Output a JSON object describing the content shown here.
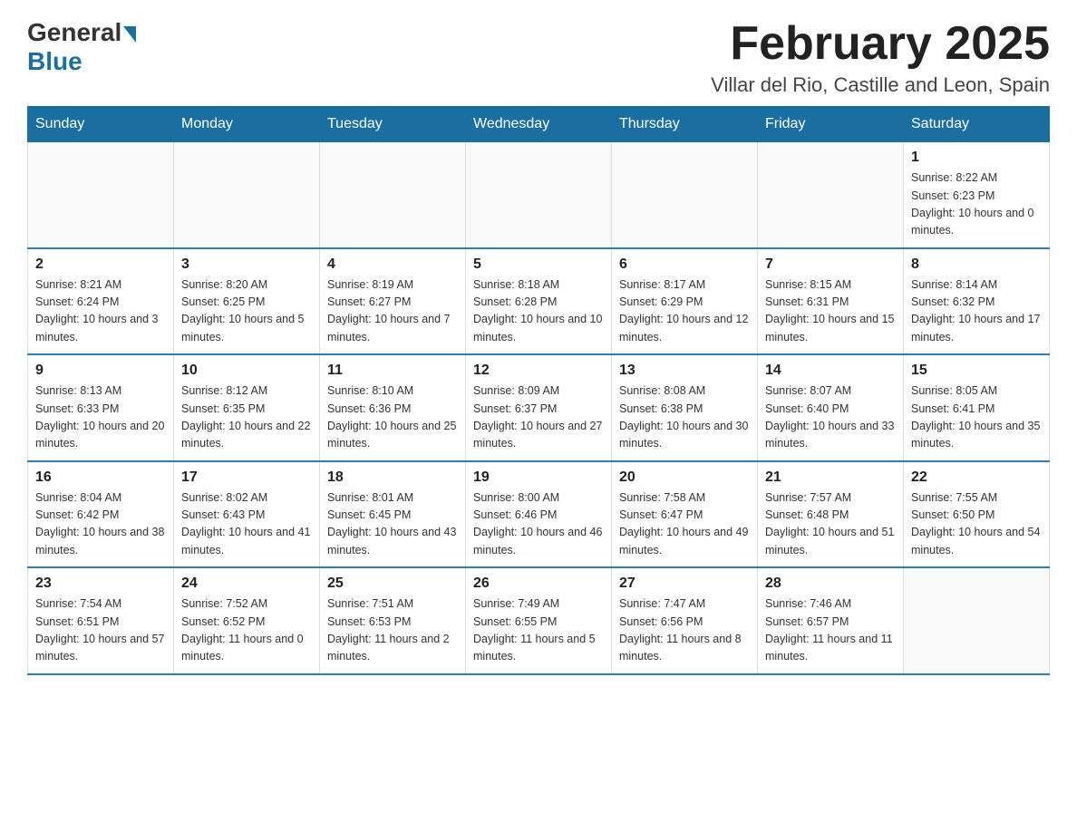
{
  "header": {
    "logo_general": "General",
    "logo_blue": "Blue",
    "month_title": "February 2025",
    "location": "Villar del Rio, Castille and Leon, Spain"
  },
  "weekdays": [
    "Sunday",
    "Monday",
    "Tuesday",
    "Wednesday",
    "Thursday",
    "Friday",
    "Saturday"
  ],
  "weeks": [
    [
      {
        "day": "",
        "info": ""
      },
      {
        "day": "",
        "info": ""
      },
      {
        "day": "",
        "info": ""
      },
      {
        "day": "",
        "info": ""
      },
      {
        "day": "",
        "info": ""
      },
      {
        "day": "",
        "info": ""
      },
      {
        "day": "1",
        "info": "Sunrise: 8:22 AM\nSunset: 6:23 PM\nDaylight: 10 hours and 0 minutes."
      }
    ],
    [
      {
        "day": "2",
        "info": "Sunrise: 8:21 AM\nSunset: 6:24 PM\nDaylight: 10 hours and 3 minutes."
      },
      {
        "day": "3",
        "info": "Sunrise: 8:20 AM\nSunset: 6:25 PM\nDaylight: 10 hours and 5 minutes."
      },
      {
        "day": "4",
        "info": "Sunrise: 8:19 AM\nSunset: 6:27 PM\nDaylight: 10 hours and 7 minutes."
      },
      {
        "day": "5",
        "info": "Sunrise: 8:18 AM\nSunset: 6:28 PM\nDaylight: 10 hours and 10 minutes."
      },
      {
        "day": "6",
        "info": "Sunrise: 8:17 AM\nSunset: 6:29 PM\nDaylight: 10 hours and 12 minutes."
      },
      {
        "day": "7",
        "info": "Sunrise: 8:15 AM\nSunset: 6:31 PM\nDaylight: 10 hours and 15 minutes."
      },
      {
        "day": "8",
        "info": "Sunrise: 8:14 AM\nSunset: 6:32 PM\nDaylight: 10 hours and 17 minutes."
      }
    ],
    [
      {
        "day": "9",
        "info": "Sunrise: 8:13 AM\nSunset: 6:33 PM\nDaylight: 10 hours and 20 minutes."
      },
      {
        "day": "10",
        "info": "Sunrise: 8:12 AM\nSunset: 6:35 PM\nDaylight: 10 hours and 22 minutes."
      },
      {
        "day": "11",
        "info": "Sunrise: 8:10 AM\nSunset: 6:36 PM\nDaylight: 10 hours and 25 minutes."
      },
      {
        "day": "12",
        "info": "Sunrise: 8:09 AM\nSunset: 6:37 PM\nDaylight: 10 hours and 27 minutes."
      },
      {
        "day": "13",
        "info": "Sunrise: 8:08 AM\nSunset: 6:38 PM\nDaylight: 10 hours and 30 minutes."
      },
      {
        "day": "14",
        "info": "Sunrise: 8:07 AM\nSunset: 6:40 PM\nDaylight: 10 hours and 33 minutes."
      },
      {
        "day": "15",
        "info": "Sunrise: 8:05 AM\nSunset: 6:41 PM\nDaylight: 10 hours and 35 minutes."
      }
    ],
    [
      {
        "day": "16",
        "info": "Sunrise: 8:04 AM\nSunset: 6:42 PM\nDaylight: 10 hours and 38 minutes."
      },
      {
        "day": "17",
        "info": "Sunrise: 8:02 AM\nSunset: 6:43 PM\nDaylight: 10 hours and 41 minutes."
      },
      {
        "day": "18",
        "info": "Sunrise: 8:01 AM\nSunset: 6:45 PM\nDaylight: 10 hours and 43 minutes."
      },
      {
        "day": "19",
        "info": "Sunrise: 8:00 AM\nSunset: 6:46 PM\nDaylight: 10 hours and 46 minutes."
      },
      {
        "day": "20",
        "info": "Sunrise: 7:58 AM\nSunset: 6:47 PM\nDaylight: 10 hours and 49 minutes."
      },
      {
        "day": "21",
        "info": "Sunrise: 7:57 AM\nSunset: 6:48 PM\nDaylight: 10 hours and 51 minutes."
      },
      {
        "day": "22",
        "info": "Sunrise: 7:55 AM\nSunset: 6:50 PM\nDaylight: 10 hours and 54 minutes."
      }
    ],
    [
      {
        "day": "23",
        "info": "Sunrise: 7:54 AM\nSunset: 6:51 PM\nDaylight: 10 hours and 57 minutes."
      },
      {
        "day": "24",
        "info": "Sunrise: 7:52 AM\nSunset: 6:52 PM\nDaylight: 11 hours and 0 minutes."
      },
      {
        "day": "25",
        "info": "Sunrise: 7:51 AM\nSunset: 6:53 PM\nDaylight: 11 hours and 2 minutes."
      },
      {
        "day": "26",
        "info": "Sunrise: 7:49 AM\nSunset: 6:55 PM\nDaylight: 11 hours and 5 minutes."
      },
      {
        "day": "27",
        "info": "Sunrise: 7:47 AM\nSunset: 6:56 PM\nDaylight: 11 hours and 8 minutes."
      },
      {
        "day": "28",
        "info": "Sunrise: 7:46 AM\nSunset: 6:57 PM\nDaylight: 11 hours and 11 minutes."
      },
      {
        "day": "",
        "info": ""
      }
    ]
  ]
}
